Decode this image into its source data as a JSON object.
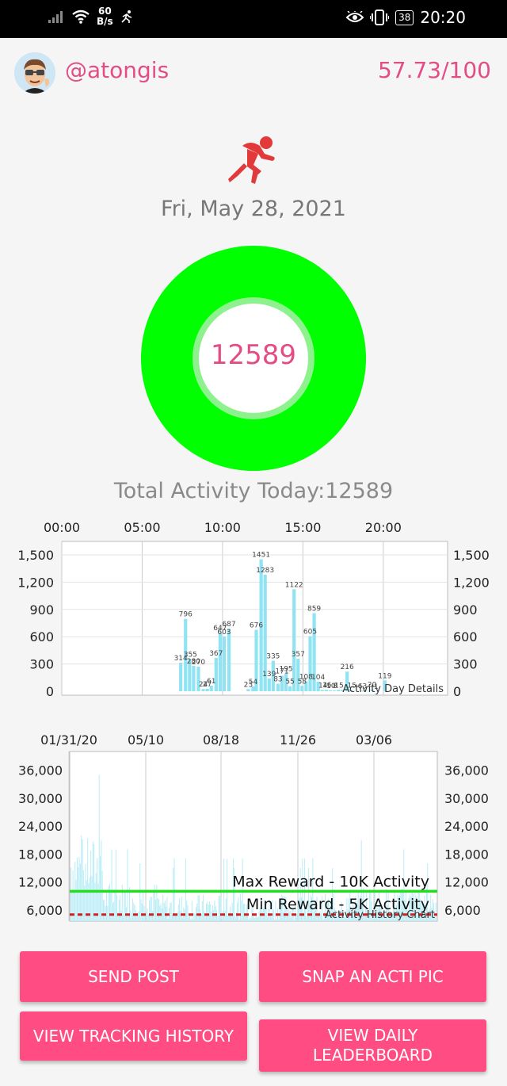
{
  "status_bar": {
    "net_speed_value": "60",
    "net_speed_unit": "B/s",
    "battery": "38",
    "time": "20:20"
  },
  "header": {
    "username": "@atongis",
    "score": "57.73/100"
  },
  "date": "Fri, May 28, 2021",
  "activity_ring": {
    "value": "12589",
    "fill_fraction": 1.0,
    "color": "#00ff00"
  },
  "total_label": "Total Activity Today:12589",
  "day_chart": {
    "x_ticks": [
      "00:00",
      "05:00",
      "10:00",
      "15:00",
      "20:00"
    ],
    "y_ticks": [
      "1,500",
      "1,200",
      "900",
      "600",
      "300",
      "0"
    ],
    "label": "Activity Day Details"
  },
  "history_chart": {
    "x_ticks": [
      "01/31/20",
      "05/10",
      "08/18",
      "11/26",
      "03/06"
    ],
    "y_ticks": [
      "36,000",
      "30,000",
      "24,000",
      "18,000",
      "12,000",
      "6,000"
    ],
    "max_reward_label": "Max Reward - 10K Activity",
    "min_reward_label": "Min Reward - 5K Activity",
    "label": "Activity History Chart"
  },
  "buttons": {
    "send_post": "SEND POST",
    "snap_pic": "SNAP AN ACTI PIC",
    "view_history": "VIEW TRACKING HISTORY",
    "view_leaderboard": "VIEW DAILY LEADERBOARD"
  },
  "chart_data": [
    {
      "type": "bar",
      "title": "Activity Day Details",
      "xlabel": "",
      "ylabel": "",
      "x_unit": "hours",
      "xlim": [
        0,
        24
      ],
      "ylim": [
        0,
        1500
      ],
      "bar_color": "#8fe3f2",
      "bars": [
        {
          "x": 7.4,
          "y": 314
        },
        {
          "x": 7.7,
          "y": 796
        },
        {
          "x": 7.95,
          "y": 355
        },
        {
          "x": 8.2,
          "y": 280
        },
        {
          "x": 8.5,
          "y": 270
        },
        {
          "x": 8.8,
          "y": 24
        },
        {
          "x": 9.05,
          "y": 27
        },
        {
          "x": 9.3,
          "y": 61
        },
        {
          "x": 9.6,
          "y": 367
        },
        {
          "x": 9.85,
          "y": 647
        },
        {
          "x": 10.1,
          "y": 603
        },
        {
          "x": 10.4,
          "y": 687
        },
        {
          "x": 11.6,
          "y": 23
        },
        {
          "x": 11.9,
          "y": 54
        },
        {
          "x": 12.1,
          "y": 676
        },
        {
          "x": 12.4,
          "y": 1451
        },
        {
          "x": 12.65,
          "y": 1283
        },
        {
          "x": 12.9,
          "y": 139
        },
        {
          "x": 13.15,
          "y": 335
        },
        {
          "x": 13.45,
          "y": 83
        },
        {
          "x": 13.7,
          "y": 171
        },
        {
          "x": 13.95,
          "y": 195
        },
        {
          "x": 14.2,
          "y": 55
        },
        {
          "x": 14.45,
          "y": 1122
        },
        {
          "x": 14.7,
          "y": 357
        },
        {
          "x": 14.95,
          "y": 58
        },
        {
          "x": 15.2,
          "y": 108
        },
        {
          "x": 15.45,
          "y": 605
        },
        {
          "x": 15.7,
          "y": 859
        },
        {
          "x": 15.95,
          "y": 104
        },
        {
          "x": 16.2,
          "y": 14
        },
        {
          "x": 16.45,
          "y": 16
        },
        {
          "x": 16.7,
          "y": 10
        },
        {
          "x": 16.95,
          "y": 8
        },
        {
          "x": 17.2,
          "y": 15
        },
        {
          "x": 17.45,
          "y": 15
        },
        {
          "x": 17.75,
          "y": 216
        },
        {
          "x": 18.0,
          "y": 15
        },
        {
          "x": 18.7,
          "y": 6
        },
        {
          "x": 18.95,
          "y": 3
        },
        {
          "x": 19.3,
          "y": 20
        },
        {
          "x": 19.55,
          "y": 1
        },
        {
          "x": 20.1,
          "y": 119
        }
      ],
      "data_labels": [
        {
          "x": 7.4,
          "y": 314,
          "text": "314"
        },
        {
          "x": 7.7,
          "y": 796,
          "text": "796"
        },
        {
          "x": 8.0,
          "y": 355,
          "text": "355"
        },
        {
          "x": 8.2,
          "y": 280,
          "text": "280"
        },
        {
          "x": 8.5,
          "y": 270,
          "text": "270"
        },
        {
          "x": 8.8,
          "y": 24,
          "text": "24"
        },
        {
          "x": 9.05,
          "y": 27,
          "text": "27"
        },
        {
          "x": 9.3,
          "y": 61,
          "text": "61"
        },
        {
          "x": 9.6,
          "y": 367,
          "text": "367"
        },
        {
          "x": 9.85,
          "y": 647,
          "text": "647"
        },
        {
          "x": 10.1,
          "y": 603,
          "text": "603"
        },
        {
          "x": 10.4,
          "y": 687,
          "text": "687"
        },
        {
          "x": 11.6,
          "y": 23,
          "text": "23"
        },
        {
          "x": 11.9,
          "y": 54,
          "text": "54"
        },
        {
          "x": 12.1,
          "y": 676,
          "text": "676"
        },
        {
          "x": 12.4,
          "y": 1451,
          "text": "1451"
        },
        {
          "x": 12.65,
          "y": 1283,
          "text": "1283"
        },
        {
          "x": 12.9,
          "y": 139,
          "text": "139"
        },
        {
          "x": 13.15,
          "y": 335,
          "text": "335"
        },
        {
          "x": 13.45,
          "y": 83,
          "text": "83"
        },
        {
          "x": 13.7,
          "y": 171,
          "text": "171"
        },
        {
          "x": 13.95,
          "y": 195,
          "text": "195"
        },
        {
          "x": 14.2,
          "y": 55,
          "text": "55"
        },
        {
          "x": 14.45,
          "y": 1122,
          "text": "1122"
        },
        {
          "x": 14.7,
          "y": 357,
          "text": "357"
        },
        {
          "x": 14.95,
          "y": 58,
          "text": "58"
        },
        {
          "x": 15.2,
          "y": 108,
          "text": "108"
        },
        {
          "x": 15.45,
          "y": 605,
          "text": "605"
        },
        {
          "x": 15.7,
          "y": 859,
          "text": "859"
        },
        {
          "x": 15.95,
          "y": 104,
          "text": "104"
        },
        {
          "x": 16.25,
          "y": 14,
          "text": "14"
        },
        {
          "x": 16.5,
          "y": 16,
          "text": "16"
        },
        {
          "x": 16.75,
          "y": 10,
          "text": "10"
        },
        {
          "x": 17.0,
          "y": 8,
          "text": "8"
        },
        {
          "x": 17.25,
          "y": 15,
          "text": "15"
        },
        {
          "x": 17.75,
          "y": 216,
          "text": "216"
        },
        {
          "x": 18.05,
          "y": 15,
          "text": "15"
        },
        {
          "x": 18.7,
          "y": 6,
          "text": "63"
        },
        {
          "x": 19.3,
          "y": 20,
          "text": "20"
        },
        {
          "x": 19.55,
          "y": 1,
          "text": "1"
        },
        {
          "x": 20.1,
          "y": 119,
          "text": "119"
        }
      ]
    },
    {
      "type": "bar",
      "title": "Activity History Chart",
      "xlabel": "",
      "ylabel": "",
      "ylim": [
        3600,
        40000
      ],
      "bar_color": "#b9ecf6",
      "reference_lines": [
        {
          "name": "Max Reward - 10K Activity",
          "value": 10000,
          "color": "#22dd22",
          "style": "solid"
        },
        {
          "name": "Min Reward - 5K Activity",
          "value": 5000,
          "color": "#cc2222",
          "style": "dashed"
        }
      ],
      "approx_daily_profile": [
        {
          "segment": "Feb 2020",
          "typical": 16000,
          "peaks": [
            31000,
            30000,
            35000,
            25000,
            22000
          ]
        },
        {
          "segment": "Mar-Apr 2020",
          "typical": 9000,
          "peaks": [
            19000,
            16000
          ]
        },
        {
          "segment": "May-Dec 2020",
          "typical": 7000,
          "peaks": [
            17000,
            15000
          ]
        },
        {
          "segment": "Jan-May 2021",
          "typical": 8000,
          "peaks": [
            21000,
            19000,
            16000
          ]
        }
      ]
    }
  ]
}
